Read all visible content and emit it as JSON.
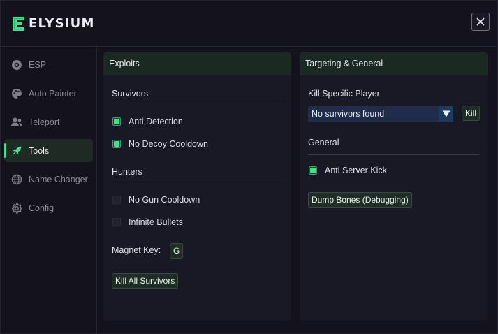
{
  "app": {
    "title": "ELYSIUM",
    "close_label": "×"
  },
  "colors": {
    "accent": "#3de28f",
    "panel_header": "#1a2a22",
    "dropdown": "#1f2d4a",
    "background": "#14131d"
  },
  "sidebar": {
    "items": [
      {
        "label": "ESP",
        "icon": "eye-icon",
        "active": false
      },
      {
        "label": "Auto Painter",
        "icon": "palette-icon",
        "active": false
      },
      {
        "label": "Teleport",
        "icon": "users-icon",
        "active": false
      },
      {
        "label": "Tools",
        "icon": "rocket-icon",
        "active": true
      },
      {
        "label": "Name Changer",
        "icon": "globe-icon",
        "active": false
      },
      {
        "label": "Config",
        "icon": "gear-icon",
        "active": false
      }
    ]
  },
  "exploits": {
    "title": "Exploits",
    "survivors_title": "Survivors",
    "anti_detection": {
      "label": "Anti Detection",
      "checked": true
    },
    "no_decoy_cooldown": {
      "label": "No Decoy Cooldown",
      "checked": true
    },
    "hunters_title": "Hunters",
    "no_gun_cooldown": {
      "label": "No Gun Cooldown",
      "checked": false
    },
    "infinite_bullets": {
      "label": "Infinite Bullets",
      "checked": false
    },
    "magnet_key_label": "Magnet Key:",
    "magnet_key_value": "G",
    "kill_all_label": "Kill All Survivors"
  },
  "targeting": {
    "title": "Targeting & General",
    "kill_specific_title": "Kill Specific Player",
    "player_select_value": "No survivors found",
    "kill_label": "Kill",
    "general_title": "General",
    "anti_server_kick": {
      "label": "Anti Server Kick",
      "checked": true
    },
    "dump_bones_label": "Dump Bones (Debugging)"
  }
}
